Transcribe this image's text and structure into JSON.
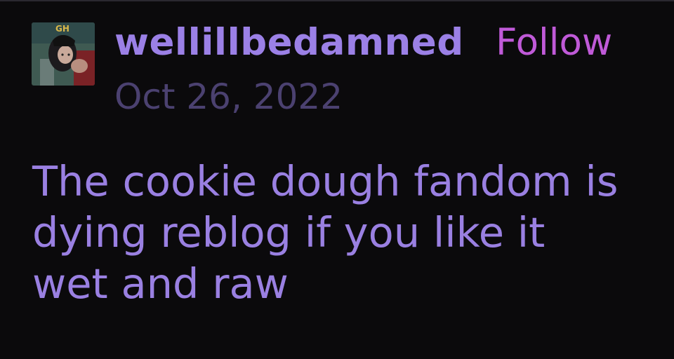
{
  "post_header": {
    "username": "wellillbedamned",
    "follow_label": "Follow",
    "date": "Oct 26, 2022",
    "avatar_text": "GH"
  },
  "post_body": {
    "lines": [
      "The cookie dough fandom is",
      "dying reblog if you like it",
      "wet and raw"
    ]
  },
  "colors": {
    "background": "#0b0a0c",
    "username": "#9b80e6",
    "follow": "#c05ad8",
    "date": "#4b4170",
    "body_text": "#9a80e2"
  }
}
